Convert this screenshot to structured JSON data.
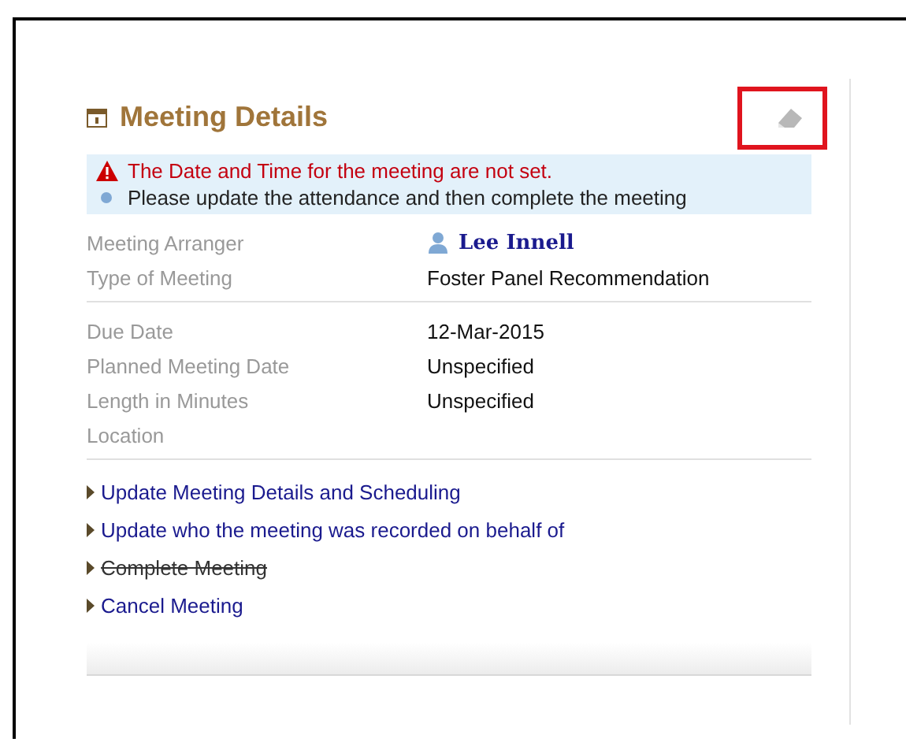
{
  "panel": {
    "title": "Meeting Details",
    "edit_button": {
      "highlighted": true
    }
  },
  "alert": {
    "error": "The Date and Time for the meeting are not set.",
    "info": "Please update the attendance and then complete the meeting"
  },
  "field_groups": [
    {
      "fields": [
        {
          "label": "Meeting Arranger",
          "value": "Lee Innell",
          "kind": "person"
        },
        {
          "label": "Type of Meeting",
          "value": "Foster Panel Recommendation",
          "kind": "text"
        }
      ]
    },
    {
      "fields": [
        {
          "label": "Due Date",
          "value": "12-Mar-2015",
          "kind": "text"
        },
        {
          "label": "Planned Meeting Date",
          "value": "Unspecified",
          "kind": "text"
        },
        {
          "label": "Length in Minutes",
          "value": "Unspecified",
          "kind": "text"
        },
        {
          "label": "Location",
          "kind": "text"
        }
      ]
    }
  ],
  "actions": [
    {
      "label": "Update Meeting Details and Scheduling",
      "disabled": false
    },
    {
      "label": "Update who the meeting was recorded on behalf of",
      "disabled": false
    },
    {
      "label": "Complete Meeting",
      "disabled": true
    },
    {
      "label": "Cancel Meeting",
      "disabled": false
    }
  ]
}
